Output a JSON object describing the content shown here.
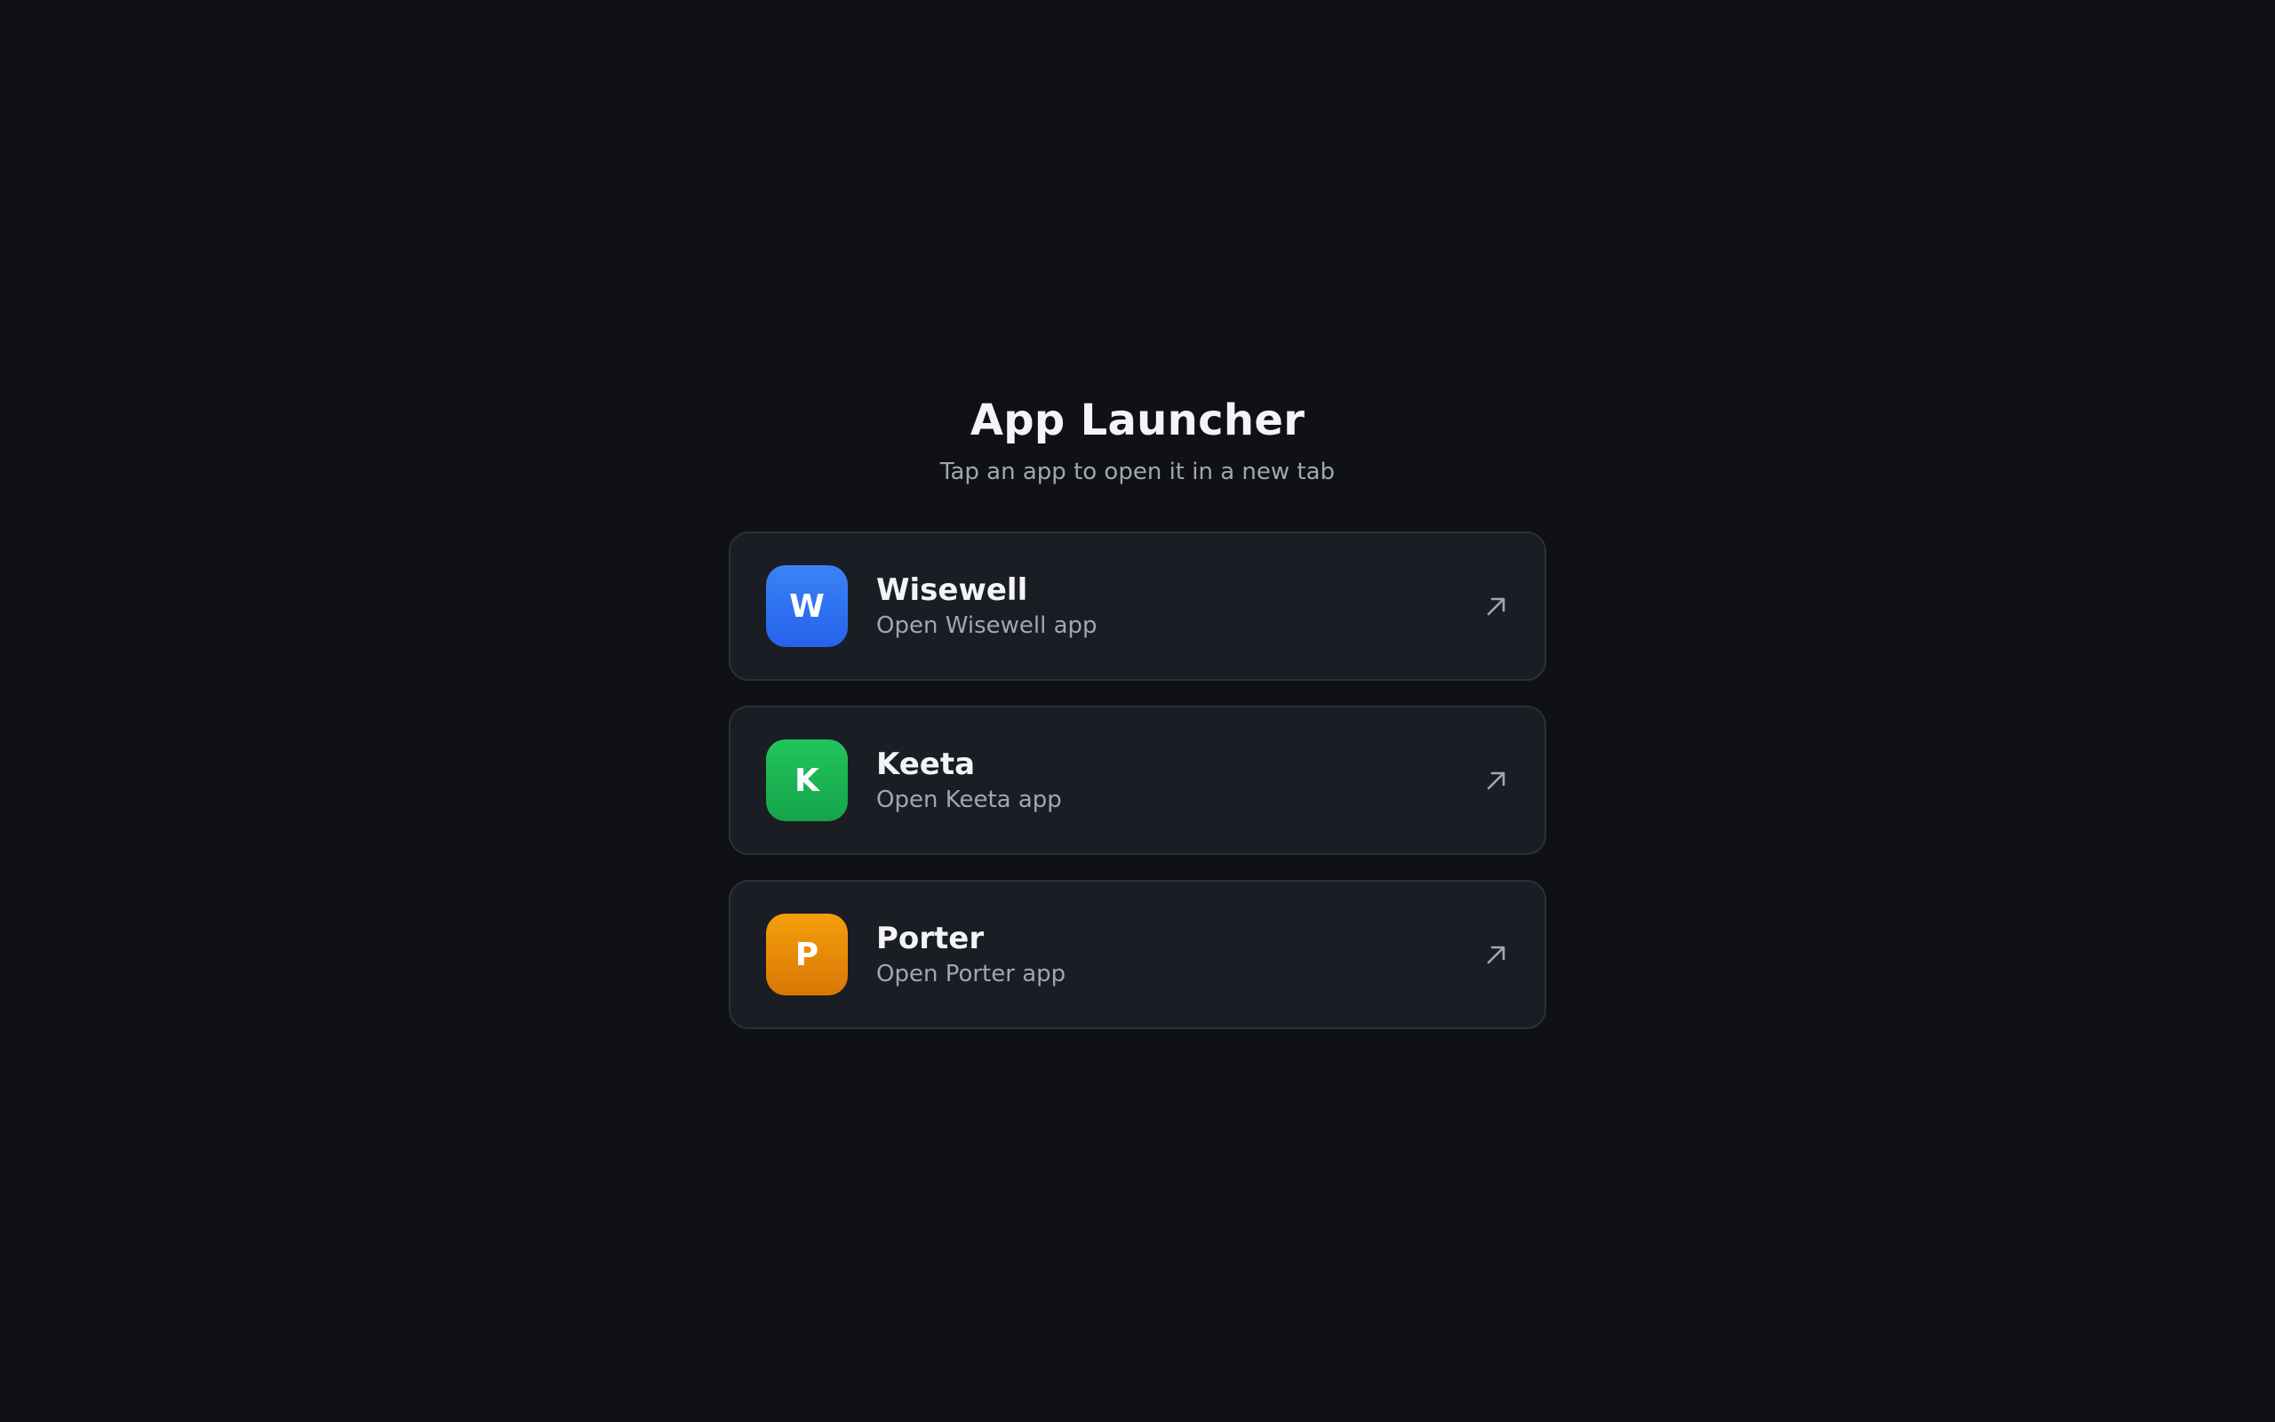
{
  "header": {
    "title": "App Launcher",
    "subtitle": "Tap an app to open it in a new tab"
  },
  "apps": [
    {
      "letter": "W",
      "name": "Wisewell",
      "description": "Open Wisewell app",
      "color_top": "#3b82f6",
      "color_bottom": "#2563eb"
    },
    {
      "letter": "K",
      "name": "Keeta",
      "description": "Open Keeta app",
      "color_top": "#22c55e",
      "color_bottom": "#16a34a"
    },
    {
      "letter": "P",
      "name": "Porter",
      "description": "Open Porter app",
      "color_top": "#f59e0b",
      "color_bottom": "#d97706"
    }
  ],
  "icons": {
    "open": "arrow-up-right-icon"
  },
  "colors": {
    "background": "#0f1115",
    "card": "#1a1d24",
    "card_border": "#2c3038",
    "text_primary": "#f3f4f6",
    "text_secondary": "#a1a6b0"
  }
}
